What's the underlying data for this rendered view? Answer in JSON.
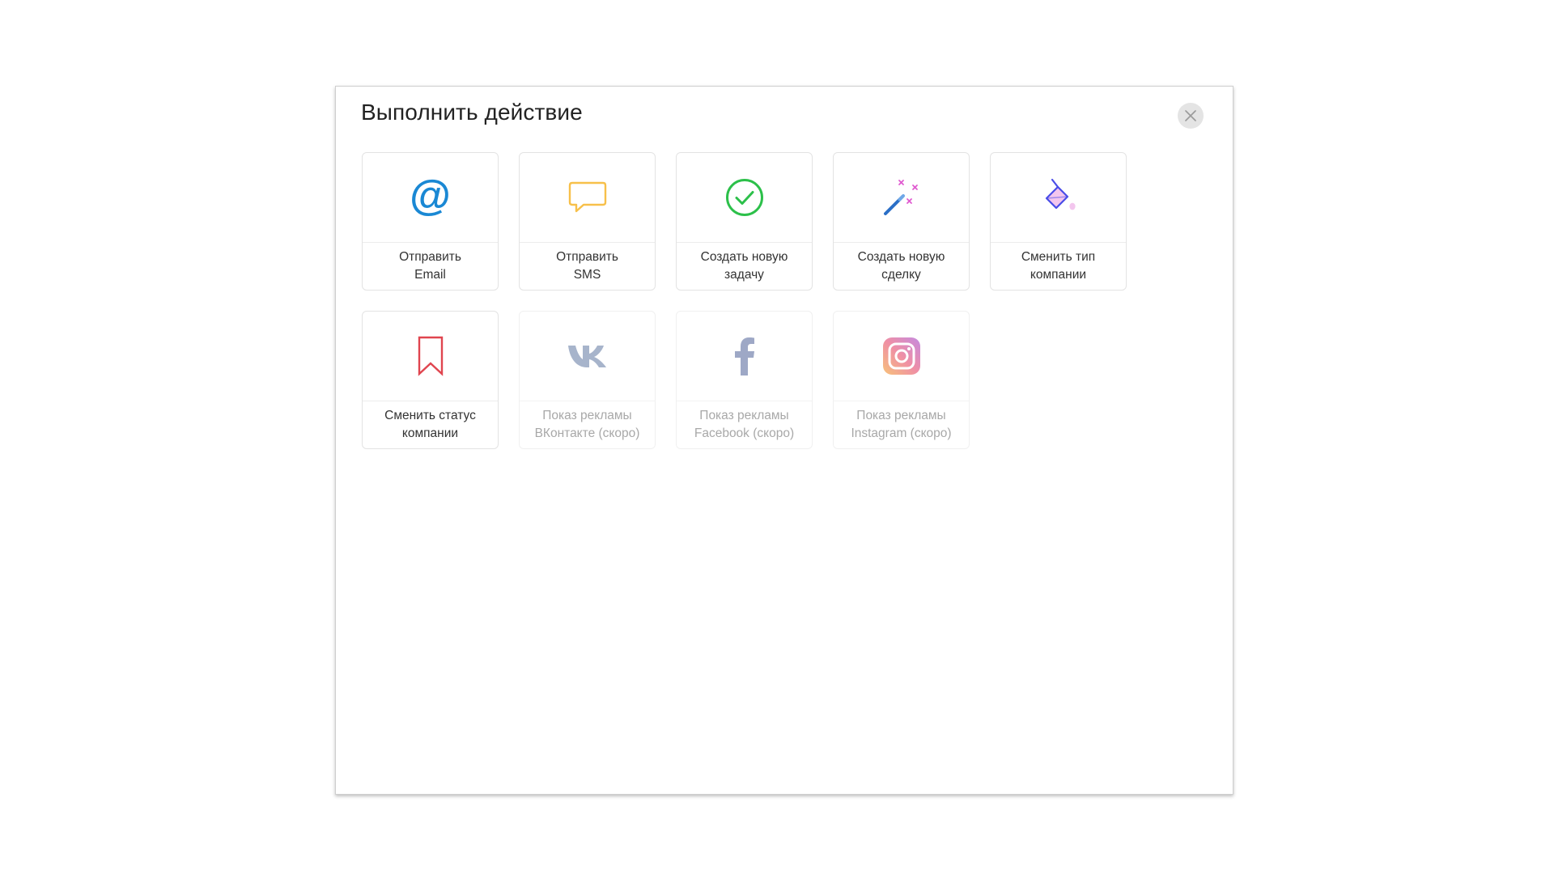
{
  "dialog": {
    "title": "Выполнить действие",
    "close_icon": "close-icon"
  },
  "actions": [
    {
      "name": "send-email",
      "label": "Отправить\nEmail",
      "icon": "at-icon",
      "color": "#1a88d4",
      "enabled": true,
      "glyph": "@"
    },
    {
      "name": "send-sms",
      "label": "Отправить\nSMS",
      "icon": "speech-bubble-icon",
      "color": "#f7c04a",
      "enabled": true
    },
    {
      "name": "create-task",
      "label": "Создать новую\nзадачу",
      "icon": "check-circle-icon",
      "color": "#2cc04a",
      "enabled": true
    },
    {
      "name": "create-deal",
      "label": "Создать новую\nсделку",
      "icon": "magic-wand-icon",
      "color": "#2b6fc7",
      "enabled": true
    },
    {
      "name": "change-company-type",
      "label": "Сменить тип\nкомпании",
      "icon": "paint-bucket-icon",
      "color": "#4a4de8",
      "enabled": true
    },
    {
      "name": "change-company-status",
      "label": "Сменить статус\nкомпании",
      "icon": "bookmark-icon",
      "color": "#e0454f",
      "enabled": true
    },
    {
      "name": "vk-ads",
      "label": "Показ рекламы\nВКонтакте (скоро)",
      "icon": "vk-icon",
      "color": "#a7b4cb",
      "enabled": false
    },
    {
      "name": "facebook-ads",
      "label": "Показ рекламы\nFacebook (скоро)",
      "icon": "facebook-icon",
      "color": "#9ea8c6",
      "enabled": false
    },
    {
      "name": "instagram-ads",
      "label": "Показ рекламы\nInstagram (скоро)",
      "icon": "instagram-icon",
      "color": "#e58db8",
      "enabled": false
    }
  ]
}
